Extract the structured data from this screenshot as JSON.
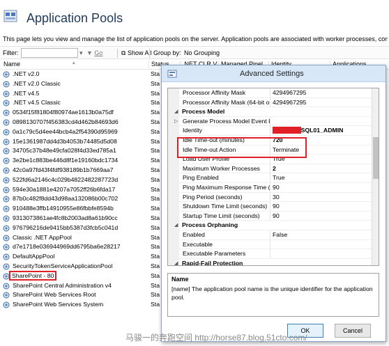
{
  "header": {
    "title": "Application Pools",
    "description": "This page lets you view and manage the list of application pools on the server. Application pools are associated with worker processes, contain o"
  },
  "filterbar": {
    "filter_label": "Filter:",
    "go_label": "Go",
    "show_all_label": "Show All",
    "group_by_label": "Group by:",
    "group_by_value": "No Grouping"
  },
  "columns": [
    "Name",
    "Status",
    ".NET CLR V...",
    "Managed Pipel...",
    "Identity",
    "Applications"
  ],
  "pools": [
    {
      "name": ".NET v2.0",
      "status": "Sta"
    },
    {
      "name": ".NET v2.0 Classic",
      "status": "Sta"
    },
    {
      "name": ".NET v4.5",
      "status": "Sta"
    },
    {
      "name": ".NET v4.5 Classic",
      "status": "Sta"
    },
    {
      "name": "0534f15f81804f80974ae1613b0a75df",
      "status": "Sta"
    },
    {
      "name": "0898130707f456383cd4d462b84693d6",
      "status": "Sta"
    },
    {
      "name": "0a1c79c5d4ee44bcb4a2f54390d95969",
      "status": "Sta"
    },
    {
      "name": "15e1361987dd4d3b4053b74485d5d08",
      "status": "Sta"
    },
    {
      "name": "34705c37b48e49cfa028f4d33ed785a1",
      "status": "Sta"
    },
    {
      "name": "3e2be1c883be446d8f1e19160bdc1734",
      "status": "Sta"
    },
    {
      "name": "42c0a97fd43f4fdf938189b1b7669aa7",
      "status": "Sta"
    },
    {
      "name": "522fd6a2146c4c029b4822482287723d",
      "status": "Sta"
    },
    {
      "name": "594e30a1881e4207a7052ff26b6fda17",
      "status": "Sta"
    },
    {
      "name": "87b0c482f8dd43d98aa132086b00c702",
      "status": "Sta"
    },
    {
      "name": "910488e3ffb14910955e86fbbfe8594b",
      "status": "Sta"
    },
    {
      "name": "9313073861ae4fc8b2003ad8a61b90cc",
      "status": "Sta"
    },
    {
      "name": "976796216de9415bb5387d3fcb5c041d",
      "status": "Sta"
    },
    {
      "name": "Classic .NET AppPool",
      "status": "Sta"
    },
    {
      "name": "d7e1718e036944969dd6795ba6e28217",
      "status": "Sta"
    },
    {
      "name": "DefaultAppPool",
      "status": "Sta"
    },
    {
      "name": "SecurityTokenServiceApplicationPool",
      "status": "Sta"
    },
    {
      "name": "SharePoint - 80",
      "status": "Sta"
    },
    {
      "name": "SharePoint Central Administration v4",
      "status": "Sta"
    },
    {
      "name": "SharePoint Web Services Root",
      "status": "Sta"
    },
    {
      "name": "SharePoint Web Services System",
      "status": "Sta"
    }
  ],
  "dialog": {
    "title": "Advanced Settings",
    "properties": [
      {
        "name": "Processor Affinity Mask",
        "value": "4294967295",
        "kind": "item"
      },
      {
        "name": "Processor Affinity Mask (64-bit o",
        "value": "4294967295",
        "kind": "item"
      },
      {
        "name": "Process Model",
        "value": "",
        "kind": "cat"
      },
      {
        "name": "Generate Process Model Event L",
        "value": "",
        "kind": "sub"
      },
      {
        "name": "Identity",
        "value": "SQL01_ADMIN",
        "kind": "identity"
      },
      {
        "name": "Idle Time-out (minutes)",
        "value": "720",
        "kind": "boldval"
      },
      {
        "name": "Idle Time-out Action",
        "value": "Terminate",
        "kind": "item"
      },
      {
        "name": "Load User Profile",
        "value": "True",
        "kind": "item"
      },
      {
        "name": "Maximum Worker Processes",
        "value": "2",
        "kind": "boldval"
      },
      {
        "name": "Ping Enabled",
        "value": "True",
        "kind": "item"
      },
      {
        "name": "Ping Maximum Response Time (",
        "value": "90",
        "kind": "item"
      },
      {
        "name": "Ping Period (seconds)",
        "value": "30",
        "kind": "item"
      },
      {
        "name": "Shutdown Time Limit (seconds)",
        "value": "90",
        "kind": "item"
      },
      {
        "name": "Startup Time Limit (seconds)",
        "value": "90",
        "kind": "item"
      },
      {
        "name": "Process Orphaning",
        "value": "",
        "kind": "cat"
      },
      {
        "name": "Enabled",
        "value": "False",
        "kind": "item"
      },
      {
        "name": "Executable",
        "value": "",
        "kind": "item"
      },
      {
        "name": "Executable Parameters",
        "value": "",
        "kind": "item"
      },
      {
        "name": "Rapid-Fail Protection",
        "value": "",
        "kind": "cat"
      }
    ],
    "desc_title": "Name",
    "desc_text": "[name] The application pool name is the unique identifier for the application pool.",
    "ok_label": "OK",
    "cancel_label": "Cancel"
  },
  "watermark": "马骏一的奔跑空间 http://horse87.blog.51cto.com/",
  "colors": {
    "highlight": "#e01f26",
    "title_text": "#1e395b",
    "dialog_title_bg": "#d8e7f8"
  }
}
